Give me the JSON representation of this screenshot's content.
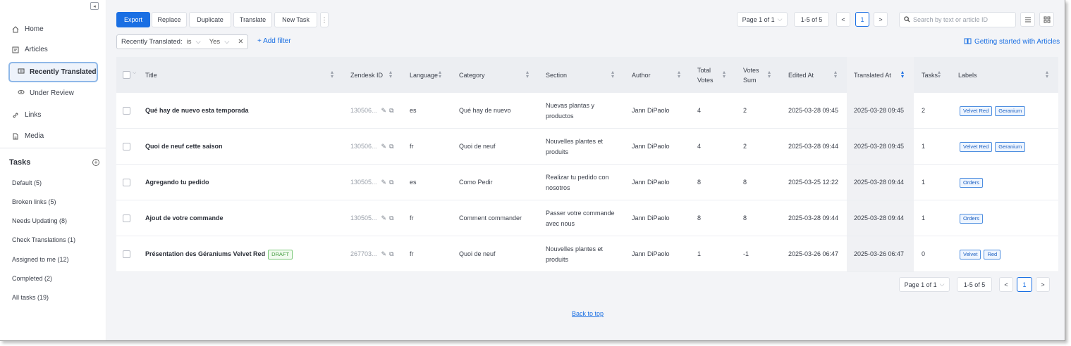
{
  "sidebar": {
    "nav": [
      {
        "label": "Home",
        "icon": "home-icon"
      },
      {
        "label": "Articles",
        "icon": "article-icon"
      }
    ],
    "sub": [
      {
        "label": "Recently Translated",
        "icon": "list-icon",
        "active": true
      },
      {
        "label": "Under Review",
        "icon": "eye-icon"
      }
    ],
    "nav2": [
      {
        "label": "Links",
        "icon": "link-icon"
      },
      {
        "label": "Media",
        "icon": "media-icon"
      }
    ],
    "tasks_title": "Tasks",
    "tasks": [
      "Default (5)",
      "Broken links (5)",
      "Needs Updating (8)",
      "Check Translations (1)",
      "Assigned to me (12)",
      "Completed (2)",
      "All tasks (19)"
    ]
  },
  "toolbar": {
    "export": "Export",
    "replace": "Replace",
    "duplicate": "Duplicate",
    "translate": "Translate",
    "new_task": "New Task",
    "more": "⋮"
  },
  "pager": {
    "page_label": "Page 1 of 1",
    "range": "1-5 of 5",
    "current": "1"
  },
  "search": {
    "placeholder": "Search by text or article ID"
  },
  "filter": {
    "field": "Recently Translated:",
    "operator": "is",
    "value": "Yes",
    "add_filter": "+ Add filter"
  },
  "getting_started": "Getting started with Articles",
  "columns": {
    "title": "Title",
    "zendesk_id": "Zendesk ID",
    "language": "Language",
    "category": "Category",
    "section": "Section",
    "author": "Author",
    "total_votes_1": "Total",
    "total_votes_2": "Votes",
    "votes_sum_1": "Votes",
    "votes_sum_2": "Sum",
    "edited_at": "Edited At",
    "translated_at": "Translated At",
    "tasks": "Tasks",
    "labels": "Labels"
  },
  "rows": [
    {
      "title": "Qué hay de nuevo esta temporada",
      "draft": "",
      "zid": "130506...",
      "lang": "es",
      "category": "Qué hay de nuevo",
      "section1": "Nuevas plantas y",
      "section2": "productos",
      "author": "Jann DiPaolo",
      "total": "4",
      "sum": "2",
      "edited": "2025-03-28 09:45",
      "translated": "2025-03-28 09:45",
      "tasks": "2",
      "labels": [
        "Velvet Red",
        "Geranium"
      ]
    },
    {
      "title": "Quoi de neuf cette saison",
      "draft": "",
      "zid": "130506...",
      "lang": "fr",
      "category": "Quoi de neuf",
      "section1": "Nouvelles plantes et",
      "section2": "produits",
      "author": "Jann DiPaolo",
      "total": "4",
      "sum": "2",
      "edited": "2025-03-28 09:44",
      "translated": "2025-03-28 09:45",
      "tasks": "1",
      "labels": [
        "Velvet Red",
        "Geranium"
      ]
    },
    {
      "title": "Agregando tu pedido",
      "draft": "",
      "zid": "130505...",
      "lang": "es",
      "category": "Como Pedir",
      "section1": "Realizar tu pedido con",
      "section2": "nosotros",
      "author": "Jann DiPaolo",
      "total": "8",
      "sum": "8",
      "edited": "2025-03-25 12:22",
      "translated": "2025-03-28 09:44",
      "tasks": "1",
      "labels": [
        "Orders"
      ]
    },
    {
      "title": "Ajout de votre commande",
      "draft": "",
      "zid": "130505...",
      "lang": "fr",
      "category": "Comment commander",
      "section1": "Passer votre commande",
      "section2": "avec nous",
      "author": "Jann DiPaolo",
      "total": "8",
      "sum": "8",
      "edited": "2025-03-28 09:44",
      "translated": "2025-03-28 09:44",
      "tasks": "1",
      "labels": [
        "Orders"
      ]
    },
    {
      "title": "Présentation des Géraniums Velvet Red",
      "draft": "DRAFT",
      "zid": "267703...",
      "lang": "fr",
      "category": "Quoi de neuf",
      "section1": "Nouvelles plantes et",
      "section2": "produits",
      "author": "Jann DiPaolo",
      "total": "1",
      "sum": "-1",
      "edited": "2025-03-26 06:47",
      "translated": "2025-03-26 06:47",
      "tasks": "0",
      "labels": [
        "Velvet",
        "Red"
      ]
    }
  ],
  "back_to_top": "Back to top",
  "colors": {
    "accent": "#1a6fe3",
    "draft": "#3f9a3c"
  }
}
